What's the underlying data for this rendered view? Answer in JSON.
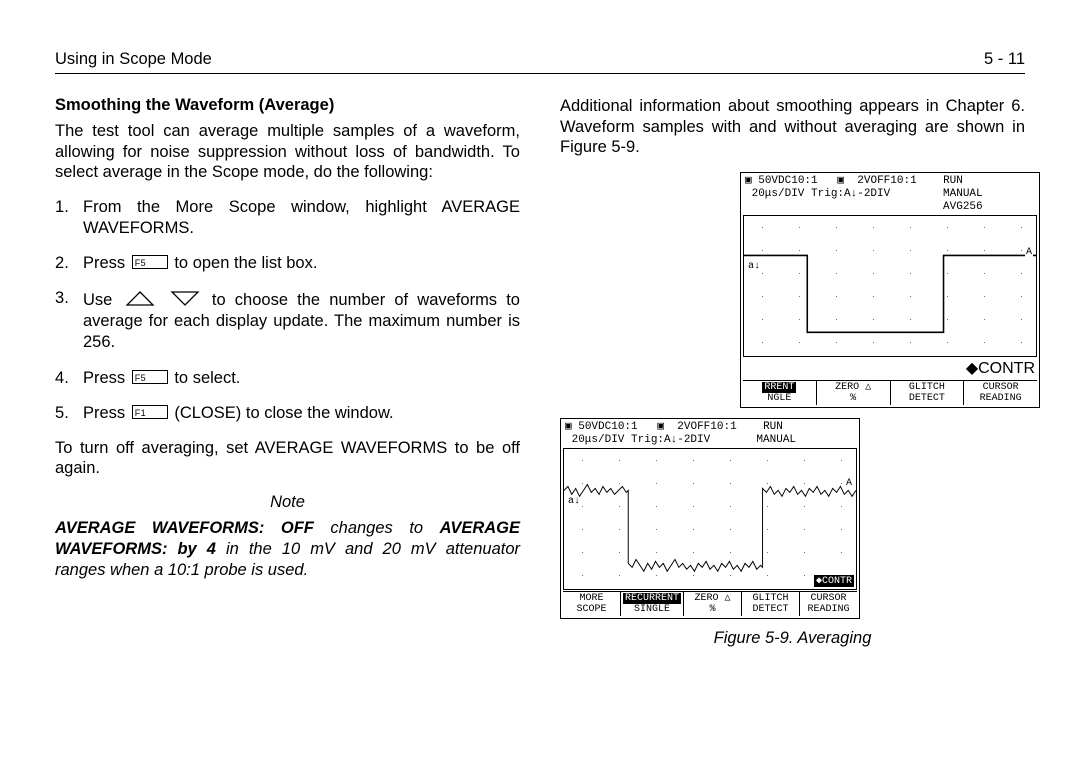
{
  "header": {
    "left": "Using in Scope Mode",
    "right": "5 - 11"
  },
  "left": {
    "title": "Smoothing the Waveform (Average)",
    "intro": "The test tool can average multiple samples of a waveform, allowing for noise suppression without loss of bandwidth. To select average in the Scope mode, do the following:",
    "steps": {
      "s1a": "From the More Scope window, highlight AVERAGE WAVEFORMS.",
      "s2a": "Press ",
      "s2b": " to open the list box.",
      "s3a": "Use ",
      "s3b": " to choose the number of waveforms to average for each display update. The maximum number is 256.",
      "s4a": "Press ",
      "s4b": " to select.",
      "s5a": "Press ",
      "s5b": " (CLOSE) to close the window."
    },
    "turnoff": "To turn off averaging, set AVERAGE WAVEFORMS to be off again.",
    "noteHead": "Note",
    "note": {
      "b1": "AVERAGE WAVEFORMS: OFF",
      "t1": " changes to ",
      "b2": "AVERAGE WAVEFORMS: by 4",
      "t2": " in the 10 mV and 20 mV attenuator ranges when a 10:1 probe is used."
    },
    "keys": {
      "f5": "F5",
      "f1": "F1"
    }
  },
  "right": {
    "intro": "Additional information about smoothing appears in Chapter 6. Waveform samples with and without averaging are shown in Figure 5-9.",
    "caption": "Figure 5-9.   Averaging",
    "scopeA": {
      "top1": "▣ 50VDC10:1   ▣  2VOFF10:1    RUN",
      "top2": " 20μs/DIV Trig:A↓-2DIV        MANUAL",
      "top3": "                              AVG256",
      "tagA": "A",
      "tagAL": "a↓",
      "contr": "◆CONTR",
      "f": {
        "c1a": "RRENT",
        "c1b": "NGLE",
        "c2a": "ZERO △",
        "c2b": "%",
        "c3a": "GLITCH",
        "c3b": "DETECT",
        "c4a": "CURSOR",
        "c4b": "READING"
      }
    },
    "scopeB": {
      "top1": "▣ 50VDC10:1   ▣  2VOFF10:1    RUN",
      "top2": " 20μs/DIV Trig:A↓-2DIV       MANUAL",
      "tagA": "A",
      "tagAL": "a↓",
      "contr": "◆CONTR",
      "f": {
        "c1a": "MORE",
        "c1b": "SCOPE",
        "c2a": "RECURRENT",
        "c2b": "SINGLE",
        "c3a": "ZERO △",
        "c3b": "%",
        "c4a": "GLITCH",
        "c4b": "DETECT",
        "c5a": "CURSOR",
        "c5b": "READING"
      }
    }
  }
}
